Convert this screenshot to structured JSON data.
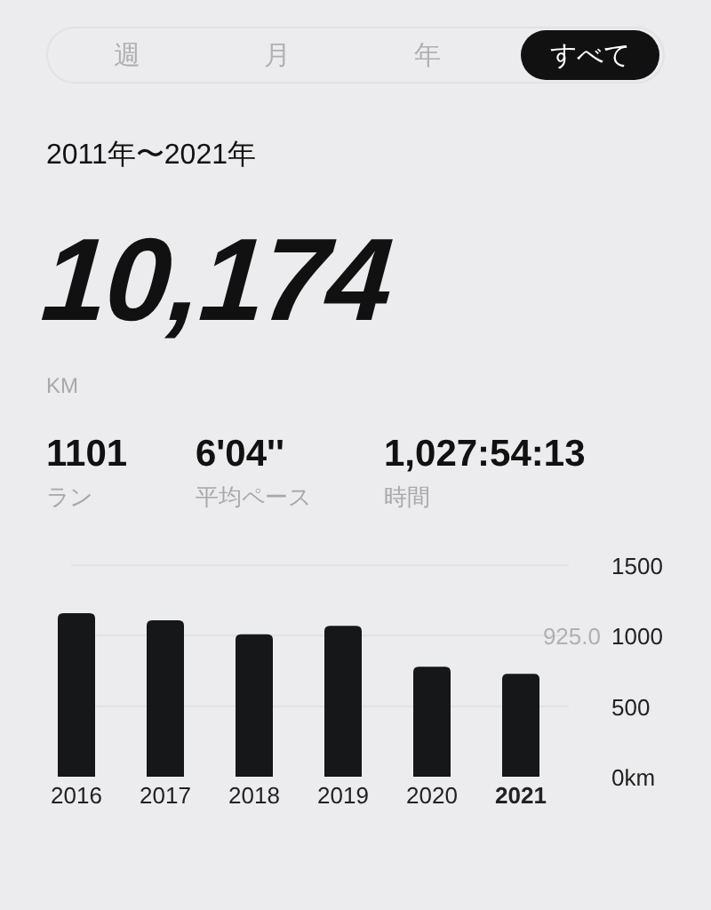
{
  "tabs": [
    {
      "label": "週",
      "selected": false
    },
    {
      "label": "月",
      "selected": false
    },
    {
      "label": "年",
      "selected": false
    },
    {
      "label": "すべて",
      "selected": true
    }
  ],
  "period": "2011年〜2021年",
  "total": {
    "value": "10,174",
    "unit": "KM"
  },
  "stats": [
    {
      "value": "1101",
      "label": "ラン"
    },
    {
      "value": "6'04''",
      "label": "平均ペース"
    },
    {
      "value": "1,027:54:13",
      "label": "時間"
    }
  ],
  "chart": {
    "highlight_last": true,
    "chart_data": {
      "type": "bar",
      "categories": [
        "2016",
        "2017",
        "2018",
        "2019",
        "2020",
        "2021"
      ],
      "series": [
        {
          "color": "#151718",
          "values": [
            1160,
            1110,
            1010,
            1070,
            780,
            730
          ]
        }
      ],
      "ylim": [
        0,
        1500
      ],
      "yticks": [
        {
          "value": 0,
          "label": "0km"
        },
        500,
        1000,
        1500
      ],
      "annotations": [
        "925.0"
      ]
    }
  }
}
